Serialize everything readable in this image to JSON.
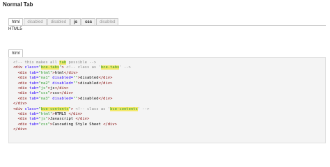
{
  "page": {
    "title": "Normal Tab"
  },
  "tabs": [
    {
      "label": "html",
      "state": "active"
    },
    {
      "label": "disabled",
      "state": "disabled"
    },
    {
      "label": "disabled",
      "state": "disabled"
    },
    {
      "label": "js",
      "state": "bold"
    },
    {
      "label": "css",
      "state": "bold"
    },
    {
      "label": "disabled",
      "state": "disabled"
    }
  ],
  "active_content": "HTML5",
  "code_tab": {
    "label": "html"
  },
  "code_lines": [
    [
      {
        "t": "c",
        "v": "<!-- this makes all "
      },
      {
        "t": "h",
        "v": "tab"
      },
      {
        "t": "c",
        "v": " possible -->"
      }
    ],
    [
      {
        "t": "g",
        "v": "<div"
      },
      {
        "t": "a",
        "v": " class="
      },
      {
        "t": "s",
        "v": "\""
      },
      {
        "t": "h",
        "v": "bce-tabs"
      },
      {
        "t": "s",
        "v": "\""
      },
      {
        "t": "g",
        "v": ">"
      },
      {
        "t": "c",
        "v": " <!-- class as '"
      },
      {
        "t": "h",
        "v": "bce-tabs"
      },
      {
        "t": "c",
        "v": "' -->"
      }
    ],
    [
      {
        "t": "x",
        "v": "  "
      },
      {
        "t": "g",
        "v": "<div"
      },
      {
        "t": "a",
        "v": " tab="
      },
      {
        "t": "s",
        "v": "\"html\""
      },
      {
        "t": "g",
        "v": ">"
      },
      {
        "t": "x",
        "v": "html"
      },
      {
        "t": "g",
        "v": "</div>"
      }
    ],
    [
      {
        "t": "x",
        "v": "  "
      },
      {
        "t": "g",
        "v": "<div"
      },
      {
        "t": "a",
        "v": " tab="
      },
      {
        "t": "s",
        "v": "\"na1\""
      },
      {
        "t": "a",
        "v": " disabled="
      },
      {
        "t": "s",
        "v": "\"\""
      },
      {
        "t": "g",
        "v": ">"
      },
      {
        "t": "x",
        "v": "disabled"
      },
      {
        "t": "g",
        "v": "</div>"
      }
    ],
    [
      {
        "t": "x",
        "v": "  "
      },
      {
        "t": "g",
        "v": "<div"
      },
      {
        "t": "a",
        "v": " tab="
      },
      {
        "t": "s",
        "v": "\"na2\""
      },
      {
        "t": "a",
        "v": " disabled="
      },
      {
        "t": "s",
        "v": "\"\""
      },
      {
        "t": "g",
        "v": ">"
      },
      {
        "t": "x",
        "v": "disabled"
      },
      {
        "t": "g",
        "v": "</div>"
      }
    ],
    [
      {
        "t": "x",
        "v": "  "
      },
      {
        "t": "g",
        "v": "<div"
      },
      {
        "t": "a",
        "v": " tab="
      },
      {
        "t": "s",
        "v": "\"js\""
      },
      {
        "t": "g",
        "v": ">"
      },
      {
        "t": "x",
        "v": "js"
      },
      {
        "t": "g",
        "v": "</div>"
      }
    ],
    [
      {
        "t": "x",
        "v": "  "
      },
      {
        "t": "g",
        "v": "<div"
      },
      {
        "t": "a",
        "v": " tab="
      },
      {
        "t": "s",
        "v": "\"css\""
      },
      {
        "t": "g",
        "v": ">"
      },
      {
        "t": "x",
        "v": "css"
      },
      {
        "t": "g",
        "v": "</div>"
      }
    ],
    [
      {
        "t": "x",
        "v": "  "
      },
      {
        "t": "g",
        "v": "<div"
      },
      {
        "t": "a",
        "v": " tab="
      },
      {
        "t": "s",
        "v": "\"na3\""
      },
      {
        "t": "a",
        "v": " disabled="
      },
      {
        "t": "s",
        "v": "\"\""
      },
      {
        "t": "g",
        "v": ">"
      },
      {
        "t": "x",
        "v": "disabled"
      },
      {
        "t": "g",
        "v": "</div>"
      }
    ],
    [
      {
        "t": "g",
        "v": "</div>"
      }
    ],
    [
      {
        "t": "g",
        "v": "<div"
      },
      {
        "t": "a",
        "v": " class="
      },
      {
        "t": "s",
        "v": "\""
      },
      {
        "t": "h",
        "v": "bce-contents"
      },
      {
        "t": "s",
        "v": "\""
      },
      {
        "t": "g",
        "v": ">"
      },
      {
        "t": "c",
        "v": " <!-- class as '"
      },
      {
        "t": "h",
        "v": "bce-contents"
      },
      {
        "t": "c",
        "v": "' -->"
      }
    ],
    [
      {
        "t": "x",
        "v": "  "
      },
      {
        "t": "g",
        "v": "<div"
      },
      {
        "t": "a",
        "v": " tab="
      },
      {
        "t": "s",
        "v": "\"html\""
      },
      {
        "t": "g",
        "v": ">"
      },
      {
        "t": "x",
        "v": "HTML5 "
      },
      {
        "t": "g",
        "v": "</div>"
      }
    ],
    [
      {
        "t": "x",
        "v": "  "
      },
      {
        "t": "g",
        "v": "<div"
      },
      {
        "t": "a",
        "v": " tab="
      },
      {
        "t": "s",
        "v": "\"js\""
      },
      {
        "t": "g",
        "v": ">"
      },
      {
        "t": "x",
        "v": "Javascript "
      },
      {
        "t": "g",
        "v": "</div>"
      }
    ],
    [
      {
        "t": "x",
        "v": "  "
      },
      {
        "t": "g",
        "v": "<div"
      },
      {
        "t": "a",
        "v": " tab="
      },
      {
        "t": "s",
        "v": "\"css\""
      },
      {
        "t": "g",
        "v": ">"
      },
      {
        "t": "x",
        "v": "Cascading Style Sheet "
      },
      {
        "t": "g",
        "v": "</div>"
      }
    ],
    [
      {
        "t": "g",
        "v": "</div>"
      }
    ]
  ]
}
